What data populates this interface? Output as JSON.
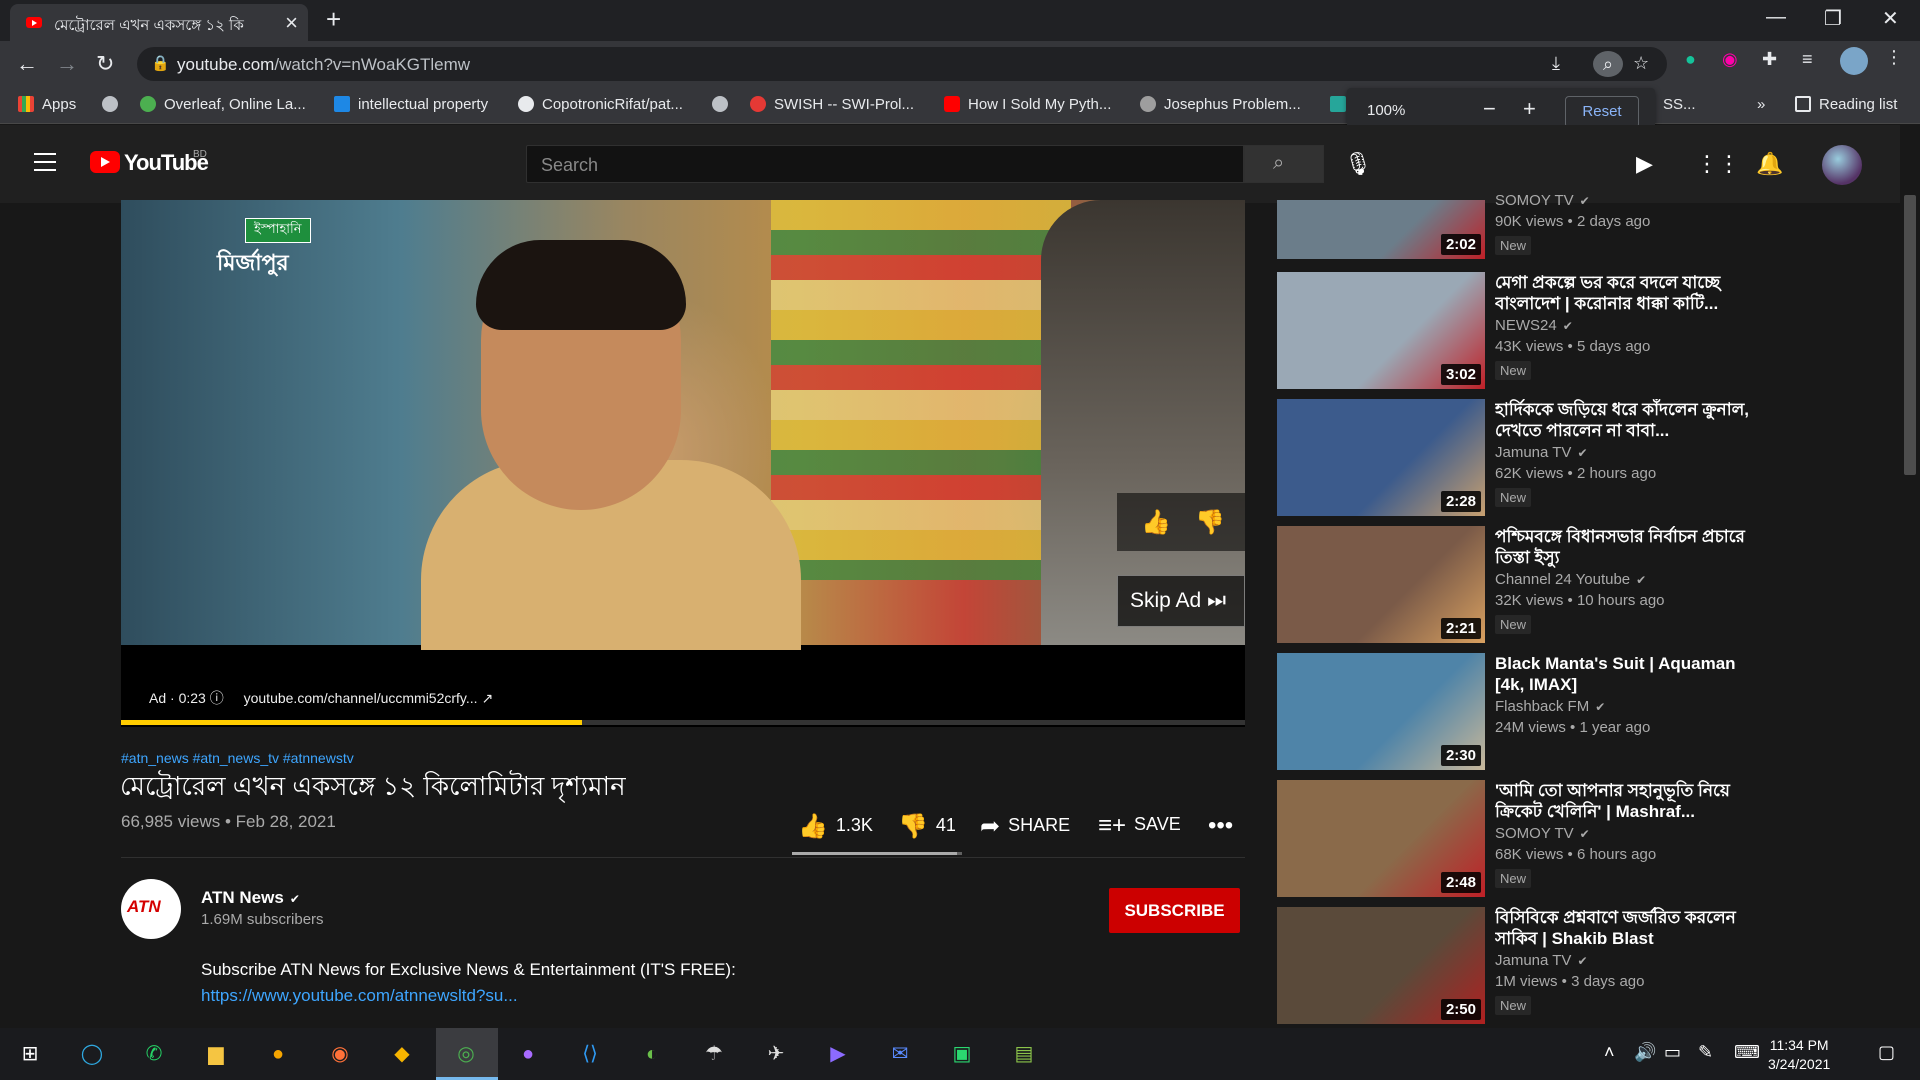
{
  "browser": {
    "tab_title": "মেট্রোরেল এখন একসঙ্গে ১২ কি",
    "url_host": "youtube.com",
    "url_path": "/watch?v=nWoaKGTlemw",
    "zoom_popup": {
      "percent": "100%",
      "minus": "−",
      "plus": "+",
      "reset": "Reset"
    },
    "bookmarks": [
      {
        "label": "Apps",
        "color": "#ea4335"
      },
      {
        "label": "",
        "color": "#bdc1c6"
      },
      {
        "label": "Overleaf, Online La...",
        "color": "#4caf50"
      },
      {
        "label": "intellectual property",
        "color": "#1e88e5"
      },
      {
        "label": "CopotronicRifat/pat...",
        "color": "#e8eaed"
      },
      {
        "label": "",
        "color": "#bdc1c6"
      },
      {
        "label": "SWISH -- SWI-Prol...",
        "color": "#e53935"
      },
      {
        "label": "How I Sold My Pyth...",
        "color": "#ff0000"
      },
      {
        "label": "Josephus Problem...",
        "color": "#9e9e9e"
      },
      {
        "label": "SS...",
        "color": "#26a69a"
      }
    ],
    "reading_list": "Reading list",
    "more": "»"
  },
  "youtube": {
    "logo_text": "YouTube",
    "country": "BD",
    "search_placeholder": "Search"
  },
  "player": {
    "sponsor_tag": "ইস্পাহানি",
    "sponsor_name": "মির্জাপুর",
    "skip_ad": "Skip Ad",
    "ad_label": "Ad · 0:23",
    "ad_url": "youtube.com/channel/uccmmi52crfy...",
    "progress": 0.41
  },
  "video": {
    "hashtags": "#atn_news #atn_news_tv #atnnewstv",
    "title": "মেট্রোরেল এখন একসঙ্গে ১২ কিলোমিটার দৃশ্যমান",
    "views": "66,985 views",
    "date": "Feb 28, 2021",
    "likes": "1.3K",
    "dislikes": "41",
    "share": "SHARE",
    "save": "SAVE",
    "channel": "ATN News",
    "subscribers": "1.69M subscribers",
    "subscribe": "SUBSCRIBE",
    "description": "Subscribe ATN News for Exclusive News & Entertainment (IT'S FREE):",
    "link": "https://www.youtube.com/atnnewsltd?su..."
  },
  "recommendations": [
    {
      "title": "",
      "channel": "SOMOY TV",
      "meta": "90K views • 2 days ago",
      "badge": "New",
      "duration": "2:02",
      "colors": [
        "#6b7d8a",
        "#c02027"
      ]
    },
    {
      "title": "মেগা প্রকল্পে ভর করে বদলে যাচ্ছে বাংলাদেশ | করোনার ধাক্কা কাটি...",
      "channel": "NEWS24",
      "meta": "43K views • 5 days ago",
      "badge": "New",
      "duration": "3:02",
      "colors": [
        "#9aa8b5",
        "#c02027"
      ]
    },
    {
      "title": "হার্দিককে জড়িয়ে ধরে কাঁদলেন ক্রুনাল, দেখতে পারলেন না বাবা...",
      "channel": "Jamuna TV",
      "meta": "62K views • 2 hours ago",
      "badge": "New",
      "duration": "2:28",
      "colors": [
        "#3c5b8c",
        "#c8a070"
      ]
    },
    {
      "title": "পশ্চিমবঙ্গে বিধানসভার নির্বাচন প্রচারে তিস্তা ইস্যু",
      "channel": "Channel 24 Youtube",
      "meta": "32K views • 10 hours ago",
      "badge": "New",
      "duration": "2:21",
      "colors": [
        "#7a5a48",
        "#d8a060"
      ]
    },
    {
      "title": "Black Manta's Suit | Aquaman [4k, IMAX]",
      "channel": "Flashback FM",
      "meta": "24M views • 1 year ago",
      "badge": "",
      "duration": "2:30",
      "colors": [
        "#4f84a8",
        "#c9b89a"
      ]
    },
    {
      "title": "'আমি তো আপনার সহানুভূতি নিয়ে ক্রিকেট খেলিনি' | Mashraf...",
      "channel": "SOMOY TV",
      "meta": "68K views • 6 hours ago",
      "badge": "New",
      "duration": "2:48",
      "colors": [
        "#8a6a4a",
        "#c02027"
      ]
    },
    {
      "title": "বিসিবিকে প্রশ্নবাণে জর্জরিত করলেন সাকিব | Shakib Blast",
      "channel": "Jamuna TV",
      "meta": "1M views • 3 days ago",
      "badge": "New",
      "duration": "2:50",
      "colors": [
        "#5a4a3a",
        "#b02020"
      ]
    }
  ],
  "taskbar": {
    "time": "11:34 PM",
    "date": "3/24/2021"
  }
}
